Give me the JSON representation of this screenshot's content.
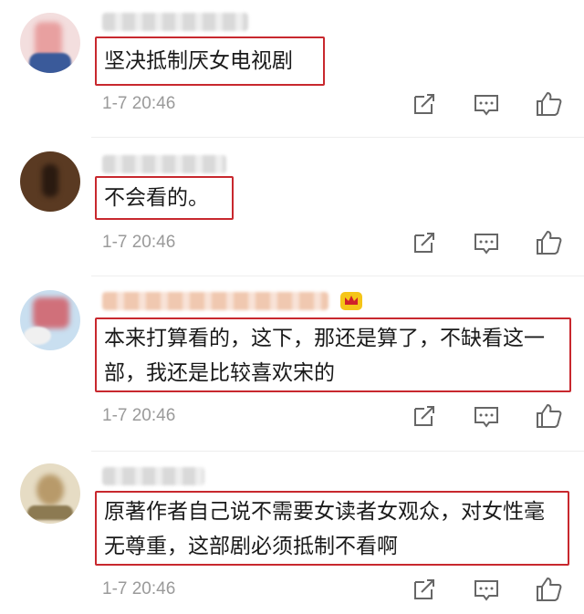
{
  "comments": [
    {
      "username": "",
      "text": "坚决抵制厌女电视剧",
      "time": "1-7 20:46",
      "avatar_color": "#e8b8b8",
      "has_crown": false
    },
    {
      "username": "",
      "text": "不会看的。",
      "time": "1-7 20:46",
      "avatar_color": "#4a2e1e",
      "has_crown": false
    },
    {
      "username": "",
      "text": "本来打算看的，这下，那还是算了，不缺看这一部，我还是比较喜欢宋的",
      "time": "1-7 20:46",
      "avatar_color": "#d8a0a8",
      "has_crown": true
    },
    {
      "username": "",
      "text": "原著作者自己说不需要女读者女观众，对女性毫无尊重，这部剧必须抵制不看啊",
      "time": "1-7 20:46",
      "avatar_color": "#c8b896",
      "has_crown": false
    }
  ],
  "icons": {
    "share": "share-icon",
    "reply": "reply-icon",
    "like": "like-icon",
    "crown": "crown-icon"
  },
  "colors": {
    "highlight_border": "#c8282e",
    "timestamp": "#9a9a9a",
    "icon": "#666666"
  }
}
